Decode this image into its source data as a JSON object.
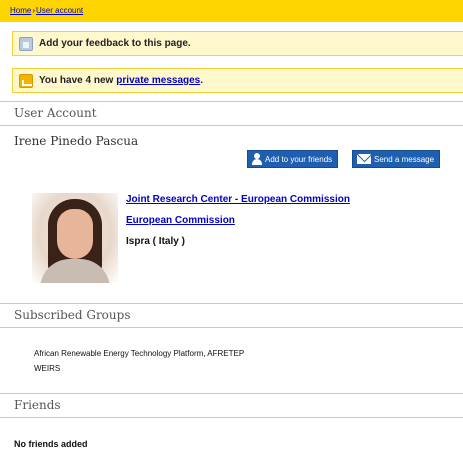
{
  "breadcrumb": {
    "home": "Home",
    "separator": "›",
    "current": "User account"
  },
  "feedback": {
    "icon": "feedback-icon",
    "text": "Add your feedback to this page."
  },
  "messages": {
    "icon": "mail-icon",
    "prefix": "You have 4 new",
    "link": "private messages",
    "suffix": "."
  },
  "user_account": {
    "heading": "User Account",
    "name": "Irene Pinedo Pascua",
    "add_friend_label": "Add to your friends",
    "send_message_label": "Send a message",
    "organizations": [
      "Joint Research Center - European Commission",
      "European Commission"
    ],
    "location": "Ispra ( Italy )"
  },
  "groups": {
    "heading": "Subscribed Groups",
    "items": [
      "African Renewable Energy Technology Platform, AFRETEP",
      "WEIRS"
    ]
  },
  "friends": {
    "heading": "Friends",
    "empty_text": "No friends added"
  },
  "colors": {
    "accent_yellow": "#ffd500",
    "notice_bg": "#fff8cc",
    "button_blue": "#1f5fb0",
    "link_blue": "#0000c8"
  }
}
